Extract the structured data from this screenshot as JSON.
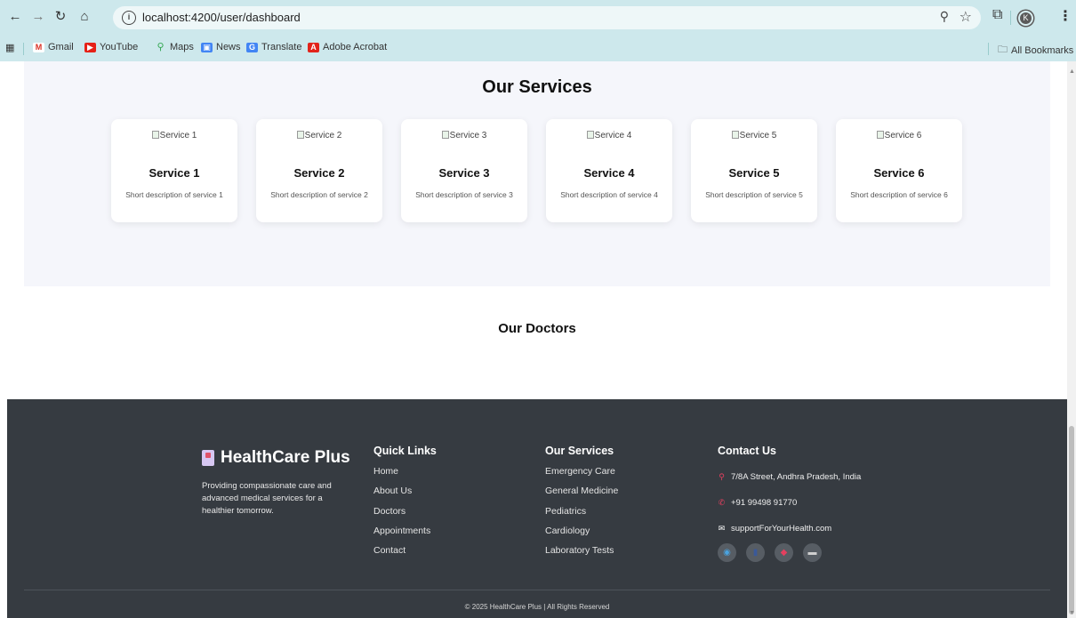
{
  "browser": {
    "url": "localhost:4200/user/dashboard",
    "bookmarks": [
      {
        "label": "Gmail",
        "icon": "gmail-icon",
        "color": "#d93025"
      },
      {
        "label": "YouTube",
        "icon": "youtube-icon",
        "color": "#e62117"
      },
      {
        "label": "Maps",
        "icon": "maps-icon",
        "color": "#34a853"
      },
      {
        "label": "News",
        "icon": "news-icon",
        "color": "#4285f4"
      },
      {
        "label": "Translate",
        "icon": "translate-icon",
        "color": "#4285f4"
      },
      {
        "label": "Adobe Acrobat",
        "icon": "acrobat-icon",
        "color": "#e2231a"
      }
    ],
    "all_bookmarks": "All Bookmarks",
    "profile_initial": "K"
  },
  "services": {
    "title": "Our Services",
    "items": [
      {
        "img_alt": "Service 1",
        "name": "Service 1",
        "desc": "Short description of service 1"
      },
      {
        "img_alt": "Service 2",
        "name": "Service 2",
        "desc": "Short description of service 2"
      },
      {
        "img_alt": "Service 3",
        "name": "Service 3",
        "desc": "Short description of service 3"
      },
      {
        "img_alt": "Service 4",
        "name": "Service 4",
        "desc": "Short description of service 4"
      },
      {
        "img_alt": "Service 5",
        "name": "Service 5",
        "desc": "Short description of service 5"
      },
      {
        "img_alt": "Service 6",
        "name": "Service 6",
        "desc": "Short description of service 6"
      }
    ]
  },
  "doctors": {
    "title": "Our Doctors"
  },
  "footer": {
    "brand": "HealthCare Plus",
    "about": "Providing compassionate care and advanced medical services for a healthier tomorrow.",
    "quick_links": {
      "title": "Quick Links",
      "items": [
        "Home",
        "About Us",
        "Doctors",
        "Appointments",
        "Contact"
      ]
    },
    "our_services": {
      "title": "Our Services",
      "items": [
        "Emergency Care",
        "General Medicine",
        "Pediatrics",
        "Cardiology",
        "Laboratory Tests"
      ]
    },
    "contact": {
      "title": "Contact Us",
      "address": "7/8A Street, Andhra Pradesh, India",
      "phone": "+91 99498 91770",
      "email": "supportForYourHealth.com",
      "socials": [
        "globe-icon",
        "facebook-icon",
        "instagram-icon",
        "linkedin-icon"
      ]
    },
    "copyright": "© 2025 HealthCare Plus | All Rights Reserved"
  }
}
